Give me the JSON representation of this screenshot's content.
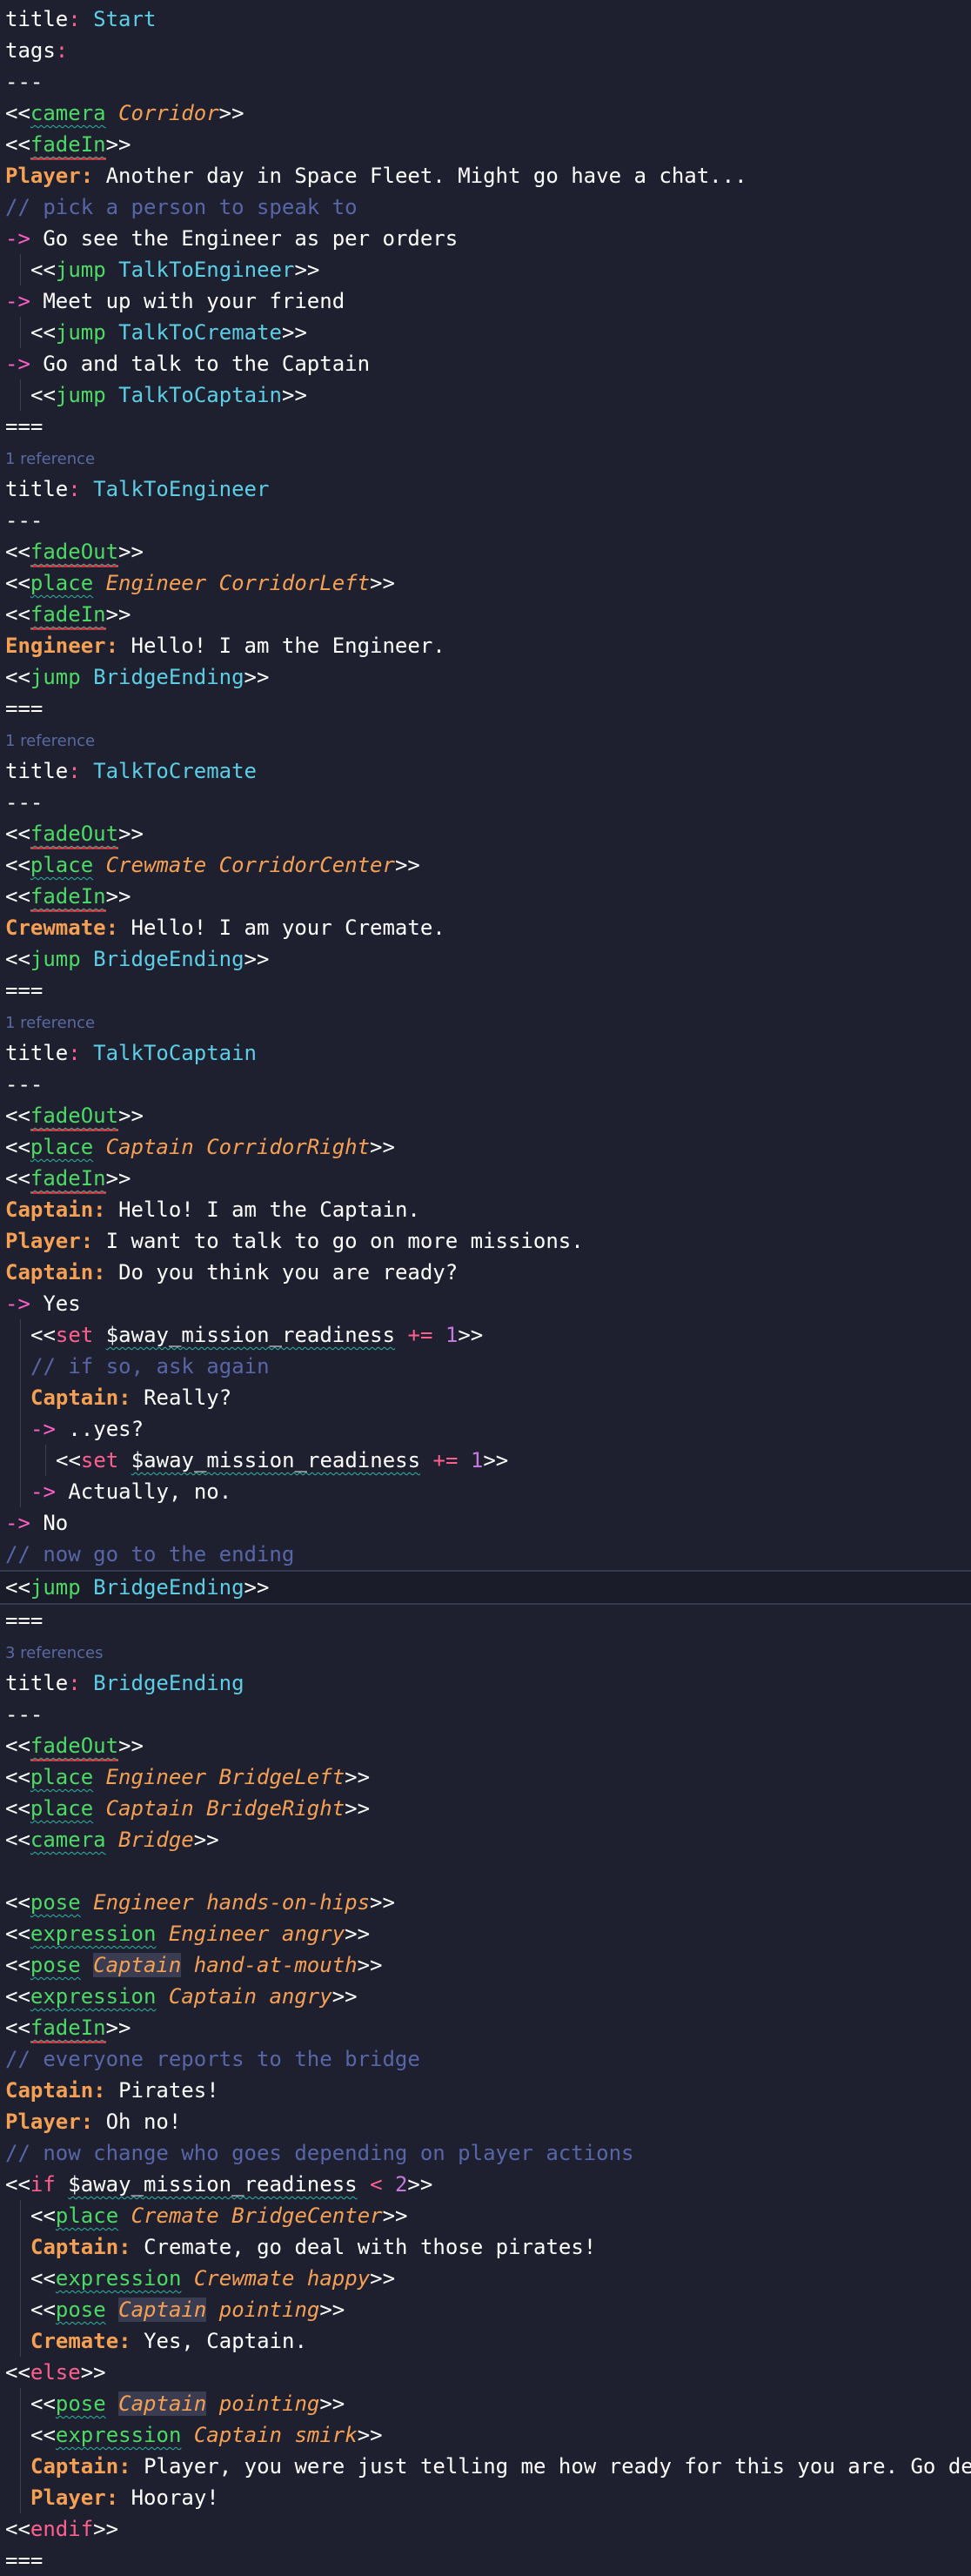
{
  "lines": [
    {
      "k": "key",
      "key": "title",
      "value": "Start"
    },
    {
      "k": "key",
      "key": "tags",
      "value": ""
    },
    {
      "k": "sep",
      "text": "---"
    },
    {
      "k": "cmd",
      "cmd": "camera",
      "args": "Corridor",
      "ind": 0
    },
    {
      "k": "cmd",
      "cmd": "fadeIn",
      "args": "",
      "ind": 0,
      "err": true
    },
    {
      "k": "dlg",
      "speaker": "Player",
      "text": "Another day in Space Fleet. Might go have a chat...",
      "ind": 0
    },
    {
      "k": "comment",
      "text": "// pick a person to speak to",
      "ind": 0
    },
    {
      "k": "opt",
      "text": "Go see the Engineer as per orders",
      "ind": 0
    },
    {
      "k": "jump",
      "node": "TalkToEngineer",
      "ind": 1
    },
    {
      "k": "opt",
      "text": "Meet up with your friend",
      "ind": 0
    },
    {
      "k": "jump",
      "node": "TalkToCremate",
      "ind": 1
    },
    {
      "k": "opt",
      "text": "Go and talk to the Captain",
      "ind": 0
    },
    {
      "k": "jump",
      "node": "TalkToCaptain",
      "ind": 1
    },
    {
      "k": "sep",
      "text": "==="
    },
    {
      "k": "ref",
      "text": "1 reference"
    },
    {
      "k": "key",
      "key": "title",
      "value": "TalkToEngineer"
    },
    {
      "k": "sep",
      "text": "---"
    },
    {
      "k": "cmd",
      "cmd": "fadeOut",
      "args": "",
      "ind": 0,
      "err": true
    },
    {
      "k": "cmd",
      "cmd": "place",
      "args": "Engineer CorridorLeft",
      "ind": 0
    },
    {
      "k": "cmd",
      "cmd": "fadeIn",
      "args": "",
      "ind": 0,
      "err": true
    },
    {
      "k": "dlg",
      "speaker": "Engineer",
      "text": "Hello! I am the Engineer.",
      "ind": 0
    },
    {
      "k": "jump",
      "node": "BridgeEnding",
      "ind": 0
    },
    {
      "k": "sep",
      "text": "==="
    },
    {
      "k": "ref",
      "text": "1 reference"
    },
    {
      "k": "key",
      "key": "title",
      "value": "TalkToCremate"
    },
    {
      "k": "sep",
      "text": "---"
    },
    {
      "k": "cmd",
      "cmd": "fadeOut",
      "args": "",
      "ind": 0,
      "err": true
    },
    {
      "k": "cmd",
      "cmd": "place",
      "args": "Crewmate CorridorCenter",
      "ind": 0
    },
    {
      "k": "cmd",
      "cmd": "fadeIn",
      "args": "",
      "ind": 0,
      "err": true
    },
    {
      "k": "dlg",
      "speaker": "Crewmate",
      "text": "Hello! I am your Cremate.",
      "ind": 0
    },
    {
      "k": "jump",
      "node": "BridgeEnding",
      "ind": 0
    },
    {
      "k": "sep",
      "text": "==="
    },
    {
      "k": "ref",
      "text": "1 reference"
    },
    {
      "k": "key",
      "key": "title",
      "value": "TalkToCaptain"
    },
    {
      "k": "sep",
      "text": "---"
    },
    {
      "k": "cmd",
      "cmd": "fadeOut",
      "args": "",
      "ind": 0,
      "err": true
    },
    {
      "k": "cmd",
      "cmd": "place",
      "args": "Captain CorridorRight",
      "ind": 0
    },
    {
      "k": "cmd",
      "cmd": "fadeIn",
      "args": "",
      "ind": 0,
      "err": true
    },
    {
      "k": "dlg",
      "speaker": "Captain",
      "text": "Hello! I am the Captain.",
      "ind": 0
    },
    {
      "k": "dlg",
      "speaker": "Player",
      "text": "I want to talk to go on more missions.",
      "ind": 0
    },
    {
      "k": "dlg",
      "speaker": "Captain",
      "text": "Do you think you are ready?",
      "ind": 0
    },
    {
      "k": "opt",
      "text": "Yes",
      "ind": 0
    },
    {
      "k": "set",
      "var": "$away_mission_readiness",
      "op": "+=",
      "num": "1",
      "ind": 1
    },
    {
      "k": "comment",
      "text": "// if so, ask again",
      "ind": 1
    },
    {
      "k": "dlg",
      "speaker": "Captain",
      "text": "Really?",
      "ind": 1
    },
    {
      "k": "opt",
      "text": "..yes?",
      "ind": 1
    },
    {
      "k": "set",
      "var": "$away_mission_readiness",
      "op": "+=",
      "num": "1",
      "ind": 2
    },
    {
      "k": "opt",
      "text": "Actually, no.",
      "ind": 1
    },
    {
      "k": "opt",
      "text": "No",
      "ind": 0
    },
    {
      "k": "comment",
      "text": "// now go to the ending",
      "ind": 0
    },
    {
      "k": "jump",
      "node": "BridgeEnding",
      "ind": 0,
      "hl": true
    },
    {
      "k": "sep",
      "text": "==="
    },
    {
      "k": "ref",
      "text": "3 references"
    },
    {
      "k": "key",
      "key": "title",
      "value": "BridgeEnding"
    },
    {
      "k": "sep",
      "text": "---"
    },
    {
      "k": "cmd",
      "cmd": "fadeOut",
      "args": "",
      "ind": 0,
      "err": true
    },
    {
      "k": "cmd",
      "cmd": "place",
      "args": "Engineer BridgeLeft",
      "ind": 0
    },
    {
      "k": "cmd",
      "cmd": "place",
      "args": "Captain BridgeRight",
      "ind": 0
    },
    {
      "k": "cmd",
      "cmd": "camera",
      "args": "Bridge",
      "ind": 0
    },
    {
      "k": "blank"
    },
    {
      "k": "cmd",
      "cmd": "pose",
      "args": "Engineer hands-on-hips",
      "ind": 0
    },
    {
      "k": "cmd",
      "cmd": "expression",
      "args": "Engineer angry",
      "ind": 0
    },
    {
      "k": "cmd",
      "cmd": "pose",
      "args": "Captain hand-at-mouth",
      "ind": 0,
      "shade": "Captain"
    },
    {
      "k": "cmd",
      "cmd": "expression",
      "args": "Captain angry",
      "ind": 0
    },
    {
      "k": "cmd",
      "cmd": "fadeIn",
      "args": "",
      "ind": 0,
      "err": true
    },
    {
      "k": "comment",
      "text": "// everyone reports to the bridge",
      "ind": 0
    },
    {
      "k": "dlg",
      "speaker": "Captain",
      "text": "Pirates!",
      "ind": 0
    },
    {
      "k": "dlg",
      "speaker": "Player",
      "text": "Oh no!",
      "ind": 0
    },
    {
      "k": "comment",
      "text": "// now change who goes depending on player actions",
      "ind": 0
    },
    {
      "k": "if",
      "var": "$away_mission_readiness",
      "op": "<",
      "num": "2",
      "ind": 0
    },
    {
      "k": "cmd",
      "cmd": "place",
      "args": "Cremate BridgeCenter",
      "ind": 1
    },
    {
      "k": "dlg",
      "speaker": "Captain",
      "text": "Cremate, go deal with those pirates!",
      "ind": 1
    },
    {
      "k": "cmd",
      "cmd": "expression",
      "args": "Crewmate happy",
      "ind": 1
    },
    {
      "k": "cmd",
      "cmd": "pose",
      "args": "Captain pointing",
      "ind": 1,
      "shade": "Captain"
    },
    {
      "k": "dlg",
      "speaker": "Cremate",
      "text": "Yes, Captain.",
      "ind": 1
    },
    {
      "k": "kw",
      "word": "else",
      "ind": 0
    },
    {
      "k": "cmd",
      "cmd": "pose",
      "args": "Captain pointing",
      "ind": 1,
      "shade": "Captain"
    },
    {
      "k": "cmd",
      "cmd": "expression",
      "args": "Captain smirk",
      "ind": 1
    },
    {
      "k": "dlg",
      "speaker": "Captain",
      "text": "Player, you were just telling me how ready for this you are. Go deal with those pirates!",
      "ind": 1
    },
    {
      "k": "dlg",
      "speaker": "Player",
      "text": "Hooray!",
      "ind": 1
    },
    {
      "k": "kw",
      "word": "endif",
      "ind": 0
    },
    {
      "k": "sep",
      "text": "==="
    }
  ]
}
